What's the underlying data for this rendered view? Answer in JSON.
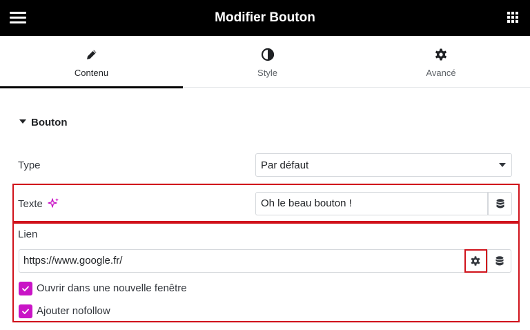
{
  "header": {
    "title": "Modifier Bouton",
    "menu_icon": "hamburger-menu-icon",
    "apps_icon": "grid-apps-icon"
  },
  "tabs": [
    {
      "label": "Contenu",
      "icon": "pencil-icon",
      "active": true
    },
    {
      "label": "Style",
      "icon": "half-circle-contrast-icon",
      "active": false
    },
    {
      "label": "Avancé",
      "icon": "gear-icon",
      "active": false
    }
  ],
  "section": {
    "title": "Bouton"
  },
  "fields": {
    "type": {
      "label": "Type",
      "value": "Par défaut"
    },
    "texte": {
      "label": "Texte",
      "value": "Oh le beau bouton !",
      "ai_icon": "sparkle-ai-icon"
    },
    "lien": {
      "label": "Lien",
      "value": "https://www.google.fr/",
      "options": [
        {
          "label": "Ouvrir dans une nouvelle fenêtre",
          "checked": true
        },
        {
          "label": "Ajouter nofollow",
          "checked": true
        }
      ]
    }
  },
  "colors": {
    "accent_checkbox": "#c914c6",
    "highlight_border": "#d0121b",
    "ai_icon": "#c914c6"
  }
}
